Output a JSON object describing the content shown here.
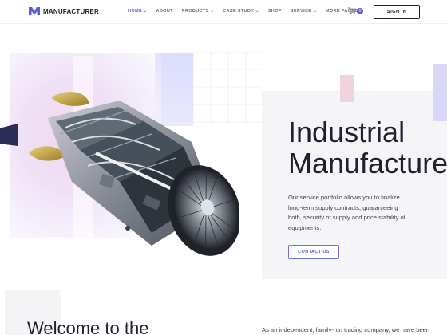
{
  "brand": {
    "name": "MANUFACTURER",
    "accent": "#5b5bd6",
    "logo_icon": "m-logo-icon"
  },
  "nav": {
    "items": [
      {
        "label": "HOME",
        "active": true,
        "dropdown": true
      },
      {
        "label": "ABOUT",
        "active": false,
        "dropdown": false
      },
      {
        "label": "PRODUCTS",
        "active": false,
        "dropdown": true
      },
      {
        "label": "CASE STUDY",
        "active": false,
        "dropdown": true
      },
      {
        "label": "SHOP",
        "active": false,
        "dropdown": false
      },
      {
        "label": "SERVICE",
        "active": false,
        "dropdown": true
      },
      {
        "label": "MORE PAGES",
        "active": false,
        "dropdown": true
      }
    ],
    "cart_count": "0",
    "signin_label": "SIGN IN"
  },
  "hero": {
    "title_line1": "Industrial",
    "title_line2": "Manufacturer",
    "description": "Our service portfolio allows you to finalize long-term supply contracts, guaranteeing both, security of supply and price stability of equipments.",
    "cta_label": "CONTACT US",
    "image": "jet-engine-image"
  },
  "section": {
    "welcome_title": "Welcome to the",
    "about_text": "As an independent, family-run trading company, we have been"
  }
}
